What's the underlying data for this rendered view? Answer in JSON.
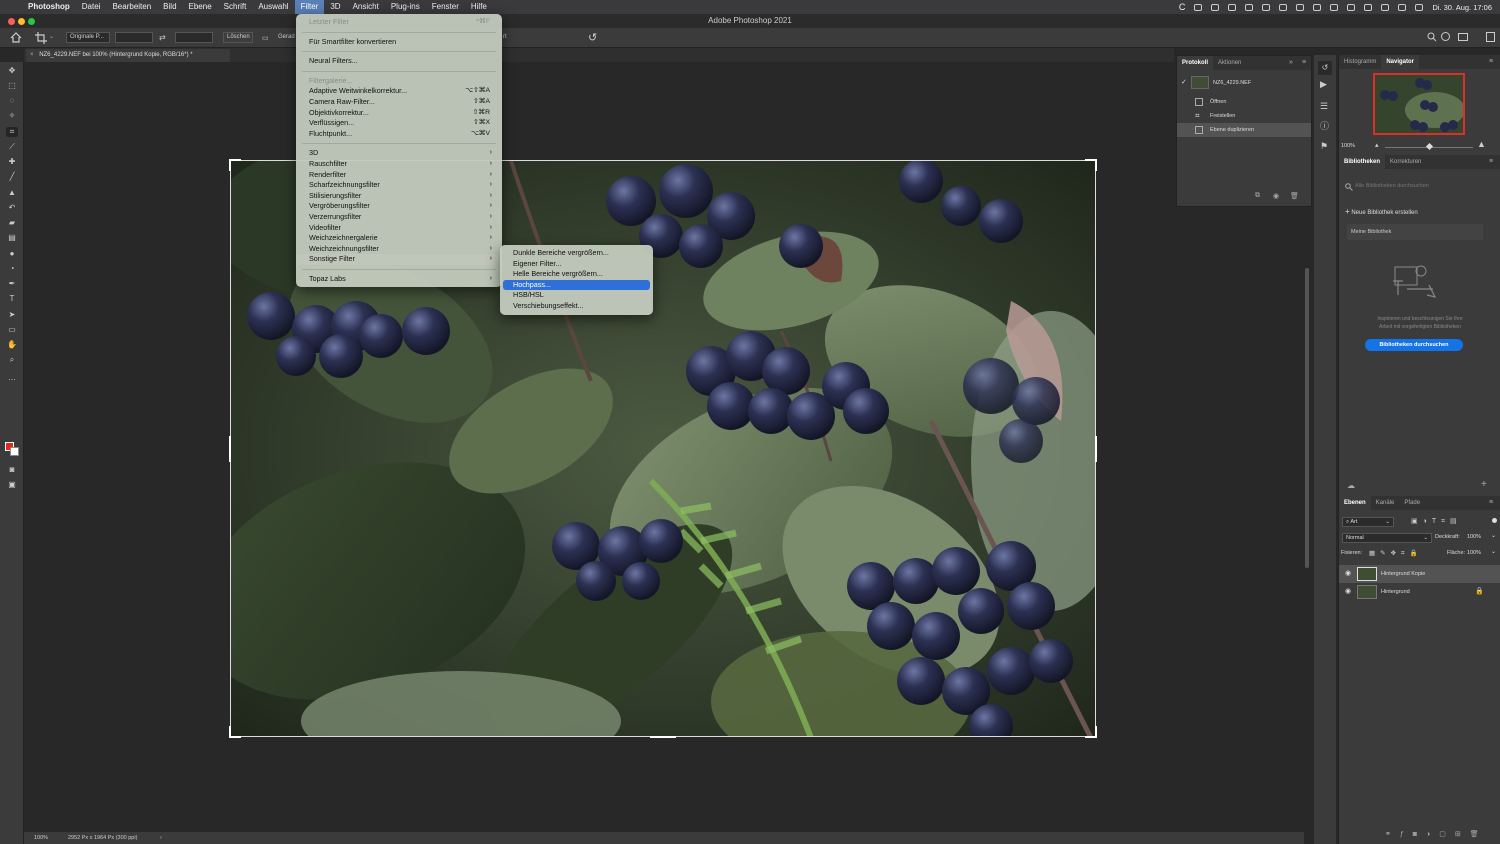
{
  "menubar": {
    "apple": "",
    "items": [
      "Photoshop",
      "Datei",
      "Bearbeiten",
      "Bild",
      "Ebene",
      "Schrift",
      "Auswahl",
      "Filter",
      "3D",
      "Ansicht",
      "Plug-ins",
      "Fenster",
      "Hilfe"
    ],
    "active_index": 7,
    "clock": "Di. 30. Aug.  17:06"
  },
  "window": {
    "title": "Adobe Photoshop 2021"
  },
  "options": {
    "ratio_preset": "Originale P...",
    "clear_label": "Löschen",
    "straighten_label": "Gerad",
    "partial_hidden": "rt"
  },
  "document": {
    "tab": "NZ6_4229.NEF bei 100% (Hintergrund Kopie, RGB/16*) *"
  },
  "status": {
    "zoom": "100%",
    "info": "2952 Px x 1964 Px (300 ppi)"
  },
  "filter_menu": {
    "items": [
      {
        "label": "Letzter Filter",
        "shortcut": "^⌘F",
        "disabled": true
      },
      {
        "sep": true
      },
      {
        "label": "Für Smartfilter konvertieren"
      },
      {
        "sep": true
      },
      {
        "label": "Neural Filters..."
      },
      {
        "sep": true
      },
      {
        "label": "Filtergalerie...",
        "disabled": true
      },
      {
        "label": "Adaptive Weitwinkelkorrektur...",
        "shortcut": "⌥⇧⌘A"
      },
      {
        "label": "Camera Raw-Filter...",
        "shortcut": "⇧⌘A"
      },
      {
        "label": "Objektivkorrektur...",
        "shortcut": "⇧⌘R"
      },
      {
        "label": "Verflüssigen...",
        "shortcut": "⇧⌘X"
      },
      {
        "label": "Fluchtpunkt...",
        "shortcut": "⌥⌘V"
      },
      {
        "sep": true
      },
      {
        "label": "3D",
        "submenu": true
      },
      {
        "label": "Rauschfilter",
        "submenu": true
      },
      {
        "label": "Renderfilter",
        "submenu": true
      },
      {
        "label": "Scharfzeichnungsfilter",
        "submenu": true
      },
      {
        "label": "Stilisierungsfilter",
        "submenu": true
      },
      {
        "label": "Vergröberungsfilter",
        "submenu": true
      },
      {
        "label": "Verzerrungsfilter",
        "submenu": true
      },
      {
        "label": "Videofilter",
        "submenu": true
      },
      {
        "label": "Weichzeichnergalerie",
        "submenu": true
      },
      {
        "label": "Weichzeichnungsfilter",
        "submenu": true
      },
      {
        "label": "Sonstige Filter",
        "submenu": true,
        "highlighted": true
      },
      {
        "sep": true
      },
      {
        "label": "Topaz Labs",
        "submenu": true
      }
    ]
  },
  "sonstige_menu": {
    "items": [
      {
        "label": "Dunkle Bereiche vergrößern..."
      },
      {
        "label": "Eigener Filter..."
      },
      {
        "label": "Helle Bereiche vergrößern..."
      },
      {
        "label": "Hochpass...",
        "selected": true
      },
      {
        "label": "HSB/HSL"
      },
      {
        "label": "Verschiebungseffekt..."
      }
    ]
  },
  "history_panel": {
    "tabs": [
      "Protokoll",
      "Aktionen"
    ],
    "snapshot": "NZ6_4229.NEF",
    "steps": [
      "Öffnen",
      "Freistellen",
      "Ebene duplizieren"
    ]
  },
  "navigator_panel": {
    "tabs": [
      "Histogramm",
      "Navigator"
    ],
    "zoom": "100%"
  },
  "libraries_panel": {
    "tabs": [
      "Bibliotheken",
      "Korrekturen"
    ],
    "search_placeholder": "Alle Bibliotheken durchsuchen",
    "new_library": "Neue Bibliothek erstellen",
    "my_library": "Meine Bibliothek",
    "info_line1": "Inspirieren und beschleunigen Sie Ihre",
    "info_line2": "Arbeit mit vorgefertigten Bibliotheken",
    "browse_button": "Bibliotheken durchsuchen"
  },
  "layers_panel": {
    "tabs": [
      "Ebenen",
      "Kanäle",
      "Pfade"
    ],
    "kind": "Art",
    "blend_mode": "Normal",
    "opacity_label": "Deckkraft:",
    "opacity": "100%",
    "lock_label": "Fixieren:",
    "fill_label": "Fläche:",
    "fill": "100%",
    "layers": [
      "Hintergrund Kopie",
      "Hintergrund"
    ]
  },
  "colors": {
    "menu_selected": "#2f6fd8",
    "foreground_swatch": "#e0291e",
    "browse_button": "#1473e6"
  }
}
